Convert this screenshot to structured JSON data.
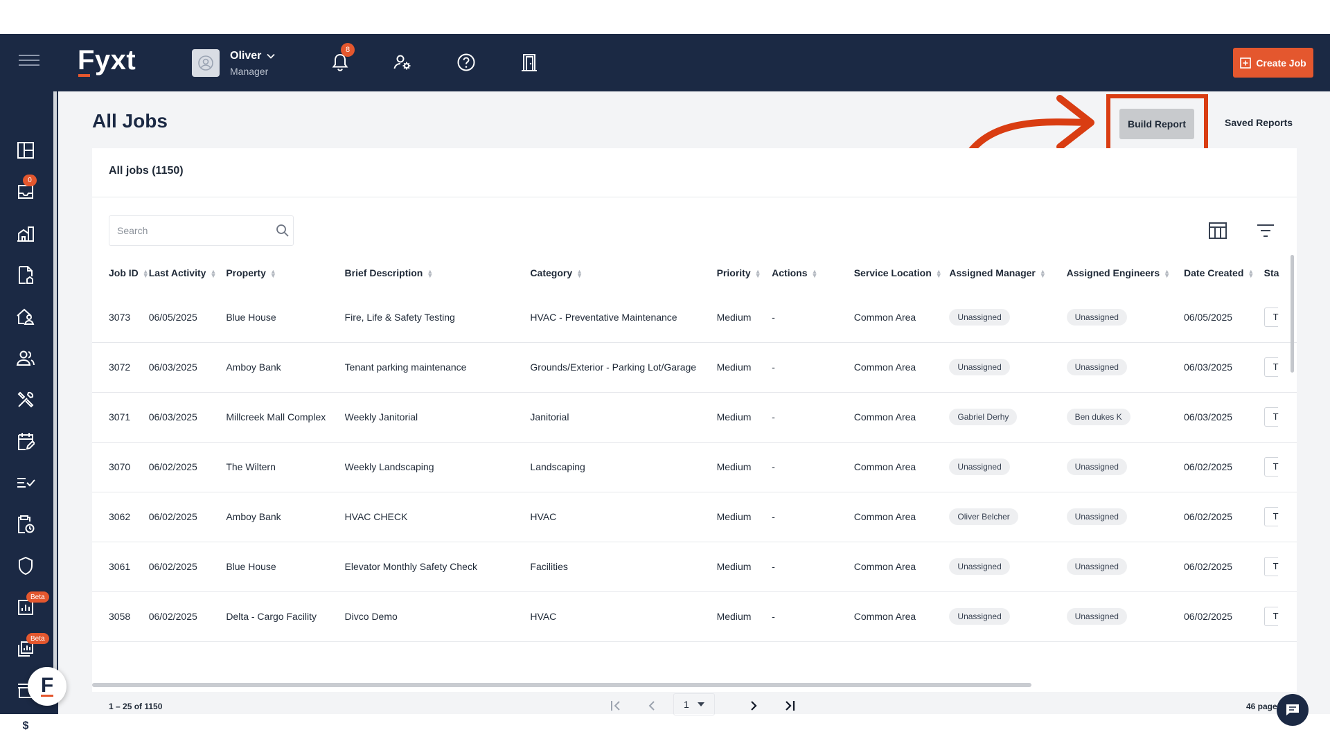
{
  "app": {
    "logo": "Fyxt",
    "accent_color": "#e4572e",
    "nav_color": "#1b2944"
  },
  "topbar": {
    "user_name": "Oliver",
    "user_role": "Manager",
    "notification_count": "8",
    "create_job_label": "Create Job",
    "icons": [
      "menu-icon",
      "bell-icon",
      "user-settings-icon",
      "help-icon",
      "door-exit-icon"
    ]
  },
  "sidebar": {
    "inbox_badge": "0",
    "beta_label": "Beta",
    "icons": [
      "dashboard-icon",
      "inbox-icon",
      "properties-icon",
      "documents-icon",
      "tenants-icon",
      "contacts-icon",
      "tools-icon",
      "calendar-icon",
      "checklist-icon",
      "clipboard-icon",
      "shield-icon",
      "reports-icon",
      "analytics-icon",
      "store-icon",
      "billing-icon"
    ],
    "fyxt_bubble": "F"
  },
  "page": {
    "title": "All Jobs",
    "build_report_label": "Build Report",
    "saved_reports_label": "Saved Reports"
  },
  "card": {
    "heading": "All jobs (1150)",
    "search_placeholder": "Search"
  },
  "table": {
    "columns": [
      "Job ID",
      "Last Activity",
      "Property",
      "Brief Description",
      "Category",
      "Priority",
      "Actions",
      "Service Location",
      "Assigned Manager",
      "Assigned Engineers",
      "Date Created",
      "Sta"
    ],
    "rows": [
      [
        "3073",
        "06/05/2025",
        "Blue House",
        "Fire, Life & Safety Testing",
        "HVAC - Preventative Maintenance",
        "Medium",
        "-",
        "Common Area",
        "Unassigned",
        "Unassigned",
        "06/05/2025",
        "T"
      ],
      [
        "3072",
        "06/03/2025",
        "Amboy Bank",
        "Tenant parking maintenance",
        "Grounds/Exterior - Parking Lot/Garage",
        "Medium",
        "-",
        "Common Area",
        "Unassigned",
        "Unassigned",
        "06/03/2025",
        "T"
      ],
      [
        "3071",
        "06/03/2025",
        "Millcreek Mall Complex",
        "Weekly Janitorial",
        "Janitorial",
        "Medium",
        "-",
        "Common Area",
        "Gabriel Derhy",
        "Ben dukes K",
        "06/03/2025",
        "T"
      ],
      [
        "3070",
        "06/02/2025",
        "The Wiltern",
        "Weekly Landscaping",
        "Landscaping",
        "Medium",
        "-",
        "Common Area",
        "Unassigned",
        "Unassigned",
        "06/02/2025",
        "T"
      ],
      [
        "3062",
        "06/02/2025",
        "Amboy Bank",
        "HVAC CHECK",
        "HVAC",
        "Medium",
        "-",
        "Common Area",
        "Oliver Belcher",
        "Unassigned",
        "06/02/2025",
        "T"
      ],
      [
        "3061",
        "06/02/2025",
        "Blue House",
        "Elevator Monthly Safety Check",
        "Facilities",
        "Medium",
        "-",
        "Common Area",
        "Unassigned",
        "Unassigned",
        "06/02/2025",
        "T"
      ],
      [
        "3058",
        "06/02/2025",
        "Delta - Cargo Facility",
        "Divco Demo",
        "HVAC",
        "Medium",
        "-",
        "Common Area",
        "Unassigned",
        "Unassigned",
        "06/02/2025",
        "T"
      ]
    ]
  },
  "pagination": {
    "range": "1 – 25 of 1150",
    "current_page": "1",
    "pages": "46 pages"
  }
}
